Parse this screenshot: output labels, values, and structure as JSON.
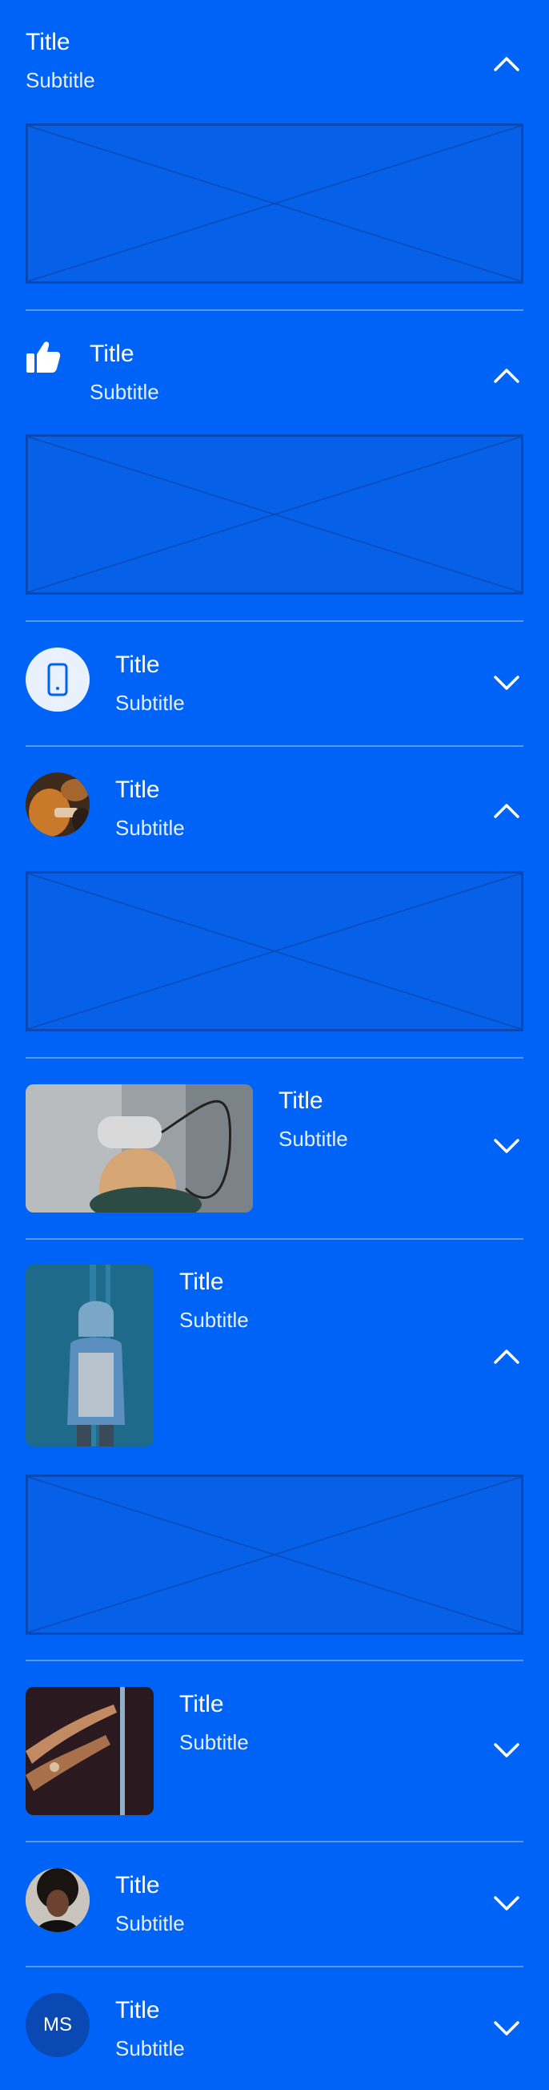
{
  "items": [
    {
      "title": "Title",
      "subtitle": "Subtitle",
      "expanded": true,
      "leading": "none"
    },
    {
      "title": "Title",
      "subtitle": "Subtitle",
      "expanded": true,
      "leading": "thumbs-up-icon"
    },
    {
      "title": "Title",
      "subtitle": "Subtitle",
      "expanded": false,
      "leading": "phone-icon"
    },
    {
      "title": "Title",
      "subtitle": "Subtitle",
      "expanded": true,
      "leading": "avatar-photo"
    },
    {
      "title": "Title",
      "subtitle": "Subtitle",
      "expanded": false,
      "leading": "wide-photo"
    },
    {
      "title": "Title",
      "subtitle": "Subtitle",
      "expanded": true,
      "leading": "tall-photo"
    },
    {
      "title": "Title",
      "subtitle": "Subtitle",
      "expanded": false,
      "leading": "square-photo"
    },
    {
      "title": "Title",
      "subtitle": "Subtitle",
      "expanded": false,
      "leading": "avatar-photo"
    },
    {
      "title": "Title",
      "subtitle": "Subtitle",
      "expanded": false,
      "leading": "initials",
      "initials": "MS"
    }
  ],
  "colors": {
    "background": "#0063F7",
    "placeholder_border": "#0A48B3",
    "text": "#FFFFFF"
  }
}
